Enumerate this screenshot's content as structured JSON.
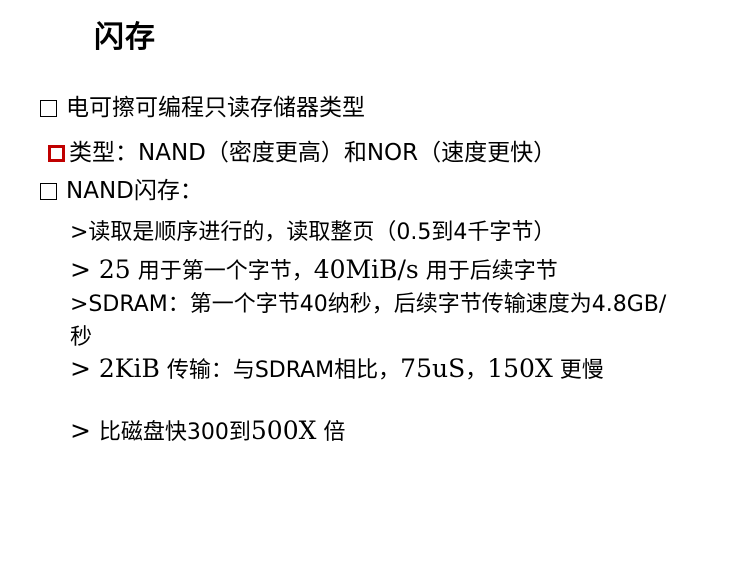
{
  "title": "闪存",
  "bullets": [
    {
      "text": "电可擦可编程只读存储器类型",
      "marker": "box",
      "marker_color": "#000000"
    },
    {
      "text": "类型：NAND（密度更高）和NOR（速度更快）",
      "marker": "box",
      "marker_color": "#c00000"
    },
    {
      "text": "NAND闪存：",
      "marker": "box",
      "marker_color": "#000000"
    }
  ],
  "sub_items": {
    "read": ">读取是顺序进行的，读取整页（0.5到4千字节）",
    "line2": {
      "a": "> 25",
      "b": " 用于第一个字节，",
      "c": "40MiB/s",
      "d": " 用于后续字节"
    },
    "sdram": ">SDRAM：第一个字节40纳秒，后续字节传输速度为4.8GB/秒",
    "line4": {
      "a": "> 2KiB",
      "b": " 传输：与SDRAM相比，",
      "c": "75uS",
      "d": "，",
      "e": "150X",
      "f": " 更慢"
    },
    "line5": {
      "a": "> ",
      "b": "比磁盘快300到",
      "c": "500X",
      "d": " 倍"
    }
  }
}
